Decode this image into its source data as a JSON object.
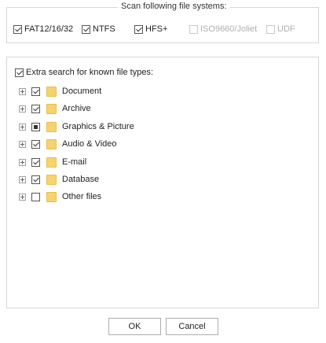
{
  "filesystems": {
    "legend": "Scan following file systems:",
    "options": [
      {
        "label": "FAT12/16/32",
        "checked": true,
        "disabled": false
      },
      {
        "label": "NTFS",
        "checked": true,
        "disabled": false
      },
      {
        "label": "HFS+",
        "checked": true,
        "disabled": false
      },
      {
        "label": "ISO9660/Joliet",
        "checked": false,
        "disabled": true
      },
      {
        "label": "UDF",
        "checked": false,
        "disabled": true
      }
    ]
  },
  "types": {
    "extra_label": "Extra search for known file types:",
    "extra_checked": true,
    "items": [
      {
        "label": "Document",
        "state": "checked"
      },
      {
        "label": "Archive",
        "state": "checked"
      },
      {
        "label": "Graphics & Picture",
        "state": "partial"
      },
      {
        "label": "Audio & Video",
        "state": "checked"
      },
      {
        "label": "E-mail",
        "state": "checked"
      },
      {
        "label": "Database",
        "state": "checked"
      },
      {
        "label": "Other files",
        "state": "unchecked"
      }
    ]
  },
  "buttons": {
    "ok": "OK",
    "cancel": "Cancel"
  },
  "colors": {
    "folder": "#f6d36e",
    "border": "#d7d7d7",
    "disabled_text": "#b0b0b0"
  }
}
